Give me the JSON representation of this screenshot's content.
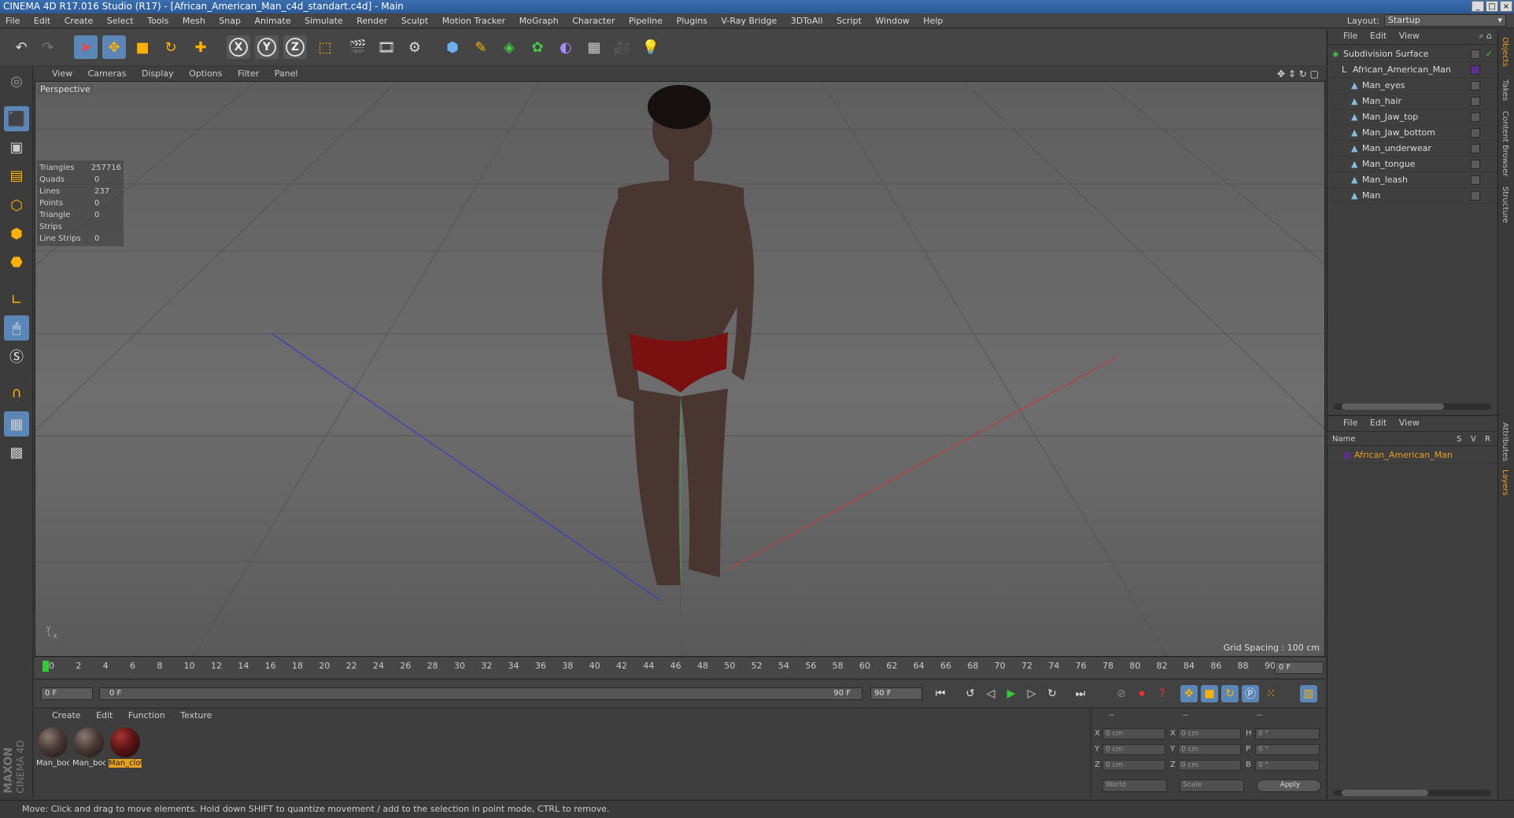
{
  "window": {
    "title": "CINEMA 4D R17.016 Studio (R17) - [African_American_Man_c4d_standart.c4d] - Main"
  },
  "menu": [
    "File",
    "Edit",
    "Create",
    "Select",
    "Tools",
    "Mesh",
    "Snap",
    "Animate",
    "Simulate",
    "Render",
    "Sculpt",
    "Motion Tracker",
    "MoGraph",
    "Character",
    "Pipeline",
    "Plugins",
    "V-Ray Bridge",
    "3DToAll",
    "Script",
    "Window",
    "Help"
  ],
  "layout": {
    "label": "Layout:",
    "value": "Startup"
  },
  "toolbar": {
    "icons": [
      "undo-icon",
      "redo-icon",
      "select-icon",
      "move-icon",
      "scale-icon",
      "rotate-icon",
      "add-icon",
      "x-axis-icon",
      "y-axis-icon",
      "z-axis-icon",
      "coord-system-icon",
      "render-view-icon",
      "render-picture-icon",
      "render-settings-icon",
      "cube-icon",
      "pen-icon",
      "subdivision-icon",
      "mograph-icon",
      "deformer-icon",
      "floor-icon",
      "camera-icon",
      "light-icon"
    ],
    "axes": [
      "X",
      "Y",
      "Z"
    ]
  },
  "viewport": {
    "menu": [
      "View",
      "Cameras",
      "Display",
      "Options",
      "Filter",
      "Panel"
    ],
    "label": "Perspective",
    "stats": [
      {
        "k": "Triangles",
        "v": "257716"
      },
      {
        "k": "Quads",
        "v": "0"
      },
      {
        "k": "Lines",
        "v": "237"
      },
      {
        "k": "Points",
        "v": "0"
      },
      {
        "k": "Triangle Strips",
        "v": "0"
      },
      {
        "k": "Line Strips",
        "v": "0"
      }
    ],
    "grid_spacing": "Grid Spacing : 100 cm"
  },
  "timeline": {
    "ticks": [
      "0",
      "2",
      "4",
      "6",
      "8",
      "10",
      "12",
      "14",
      "16",
      "18",
      "20",
      "22",
      "24",
      "26",
      "28",
      "30",
      "32",
      "34",
      "36",
      "38",
      "40",
      "42",
      "44",
      "46",
      "48",
      "50",
      "52",
      "54",
      "56",
      "58",
      "60",
      "62",
      "64",
      "66",
      "68",
      "70",
      "72",
      "74",
      "76",
      "78",
      "80",
      "82",
      "84",
      "86",
      "88",
      "90"
    ],
    "current": "0 F",
    "start": "0 F",
    "range_start": "0 F",
    "range_end": "90 F",
    "end": "90 F"
  },
  "materials": {
    "menu": [
      "Create",
      "Edit",
      "Function",
      "Texture"
    ],
    "items": [
      {
        "label": "Man_boc",
        "style": "skin"
      },
      {
        "label": "Man_boc",
        "style": "skin"
      },
      {
        "label": "Man_clot",
        "style": "red",
        "selected": true
      }
    ]
  },
  "coords": {
    "rows": [
      {
        "a": "X",
        "av": "0 cm",
        "b": "X",
        "bv": "0 cm",
        "c": "H",
        "cv": "0 °"
      },
      {
        "a": "Y",
        "av": "0 cm",
        "b": "Y",
        "bv": "0 cm",
        "c": "P",
        "cv": "0 °"
      },
      {
        "a": "Z",
        "av": "0 cm",
        "b": "Z",
        "bv": "0 cm",
        "c": "B",
        "cv": "0 °"
      }
    ],
    "headers": [
      "--",
      "--",
      "--"
    ],
    "world": "World",
    "scale": "Scale",
    "apply": "Apply"
  },
  "objects": {
    "menu": [
      "File",
      "Edit",
      "View"
    ],
    "items": [
      "Subdivision Surface",
      "African_American_Man",
      "Man_eyes",
      "Man_hair",
      "Man_Jaw_top",
      "Man_Jaw_bottom",
      "Man_underwear",
      "Man_tongue",
      "Man_leash",
      "Man"
    ]
  },
  "layers": {
    "menu": [
      "File",
      "Edit",
      "View"
    ],
    "columns": [
      "Name",
      "S",
      "V",
      "R"
    ],
    "items": [
      "African_American_Man"
    ]
  },
  "right_tabs": [
    "Objects",
    "Takes",
    "Content Browser",
    "Structure",
    "Attributes",
    "Layers"
  ],
  "status": "Move: Click and drag to move elements. Hold down SHIFT to quantize movement / add to the selection in point mode, CTRL to remove.",
  "brand": [
    "MAXON",
    "CINEMA 4D"
  ]
}
